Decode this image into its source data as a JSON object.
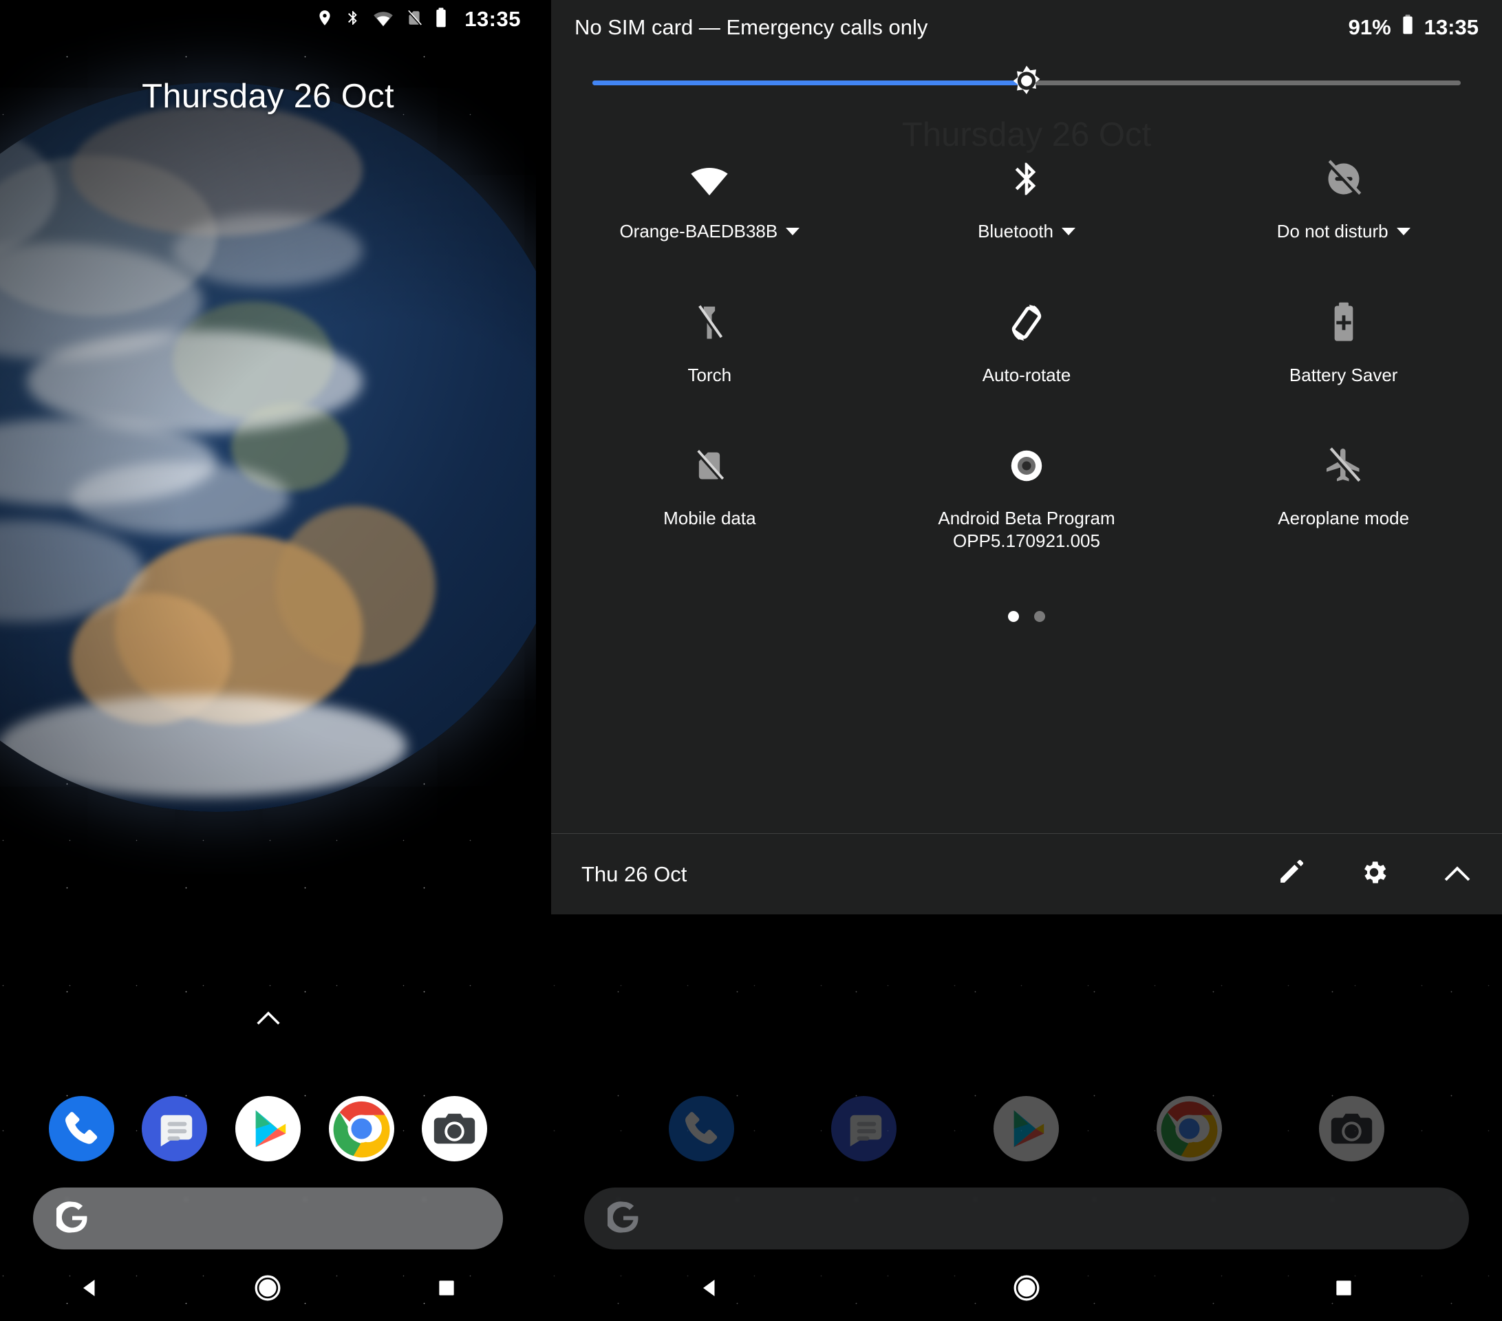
{
  "home": {
    "status_bar": {
      "icons": [
        "location-pin-icon",
        "bluetooth-icon",
        "wifi-icon",
        "no-sim-icon",
        "battery-icon"
      ],
      "time": "13:35"
    },
    "date_widget": "Thursday 26 Oct",
    "app_drawer_hint": "chevron-up-icon",
    "dock": [
      {
        "name": "phone-app-icon",
        "label": "Phone"
      },
      {
        "name": "messages-app-icon",
        "label": "Messages"
      },
      {
        "name": "play-store-app-icon",
        "label": "Play Store"
      },
      {
        "name": "chrome-app-icon",
        "label": "Chrome"
      },
      {
        "name": "camera-app-icon",
        "label": "Camera"
      }
    ],
    "search_bar": {
      "logo": "google-g-logo",
      "value": "",
      "placeholder": ""
    },
    "nav_bar": [
      {
        "name": "back-button",
        "icon": "back-triangle-icon"
      },
      {
        "name": "home-button",
        "icon": "home-circle-icon"
      },
      {
        "name": "recents-button",
        "icon": "recents-square-icon"
      }
    ]
  },
  "quick_settings": {
    "status_bar": {
      "carrier": "No SIM card — Emergency calls only",
      "battery_percent": "91%",
      "battery_icon": "battery-icon",
      "time": "13:35"
    },
    "brightness": {
      "name": "brightness-slider",
      "value": 50,
      "fill_color": "#4285f4",
      "track_color": "#6e6e6e"
    },
    "ghost_date": "Thursday 26 Oct",
    "tiles": [
      [
        {
          "label": "Orange-BAEDB38B",
          "icon": "wifi-icon",
          "state": "on",
          "caret": true
        },
        {
          "label": "Bluetooth",
          "icon": "bluetooth-icon",
          "state": "on",
          "caret": true
        },
        {
          "label": "Do not disturb",
          "icon": "do-not-disturb-icon",
          "state": "off",
          "caret": true
        }
      ],
      [
        {
          "label": "Torch",
          "icon": "torch-off-icon",
          "state": "off",
          "caret": false
        },
        {
          "label": "Auto-rotate",
          "icon": "auto-rotate-icon",
          "state": "on",
          "caret": false
        },
        {
          "label": "Battery Saver",
          "icon": "battery-saver-icon",
          "state": "off",
          "caret": false
        }
      ],
      [
        {
          "label": "Mobile data",
          "icon": "mobile-data-off-icon",
          "state": "off",
          "caret": false
        },
        {
          "label": "Android Beta Program",
          "sub": "OPP5.170921.005",
          "icon": "android-beta-icon",
          "state": "on",
          "caret": false
        },
        {
          "label": "Aeroplane mode",
          "icon": "aeroplane-mode-icon",
          "state": "off",
          "caret": false
        }
      ]
    ],
    "pager": {
      "pages": 2,
      "active": 0
    },
    "footer": {
      "date": "Thu 26 Oct",
      "actions": [
        {
          "name": "edit-tiles-button",
          "icon": "pencil-icon"
        },
        {
          "name": "settings-button",
          "icon": "gear-icon"
        },
        {
          "name": "collapse-button",
          "icon": "chevron-up-icon"
        }
      ]
    }
  }
}
